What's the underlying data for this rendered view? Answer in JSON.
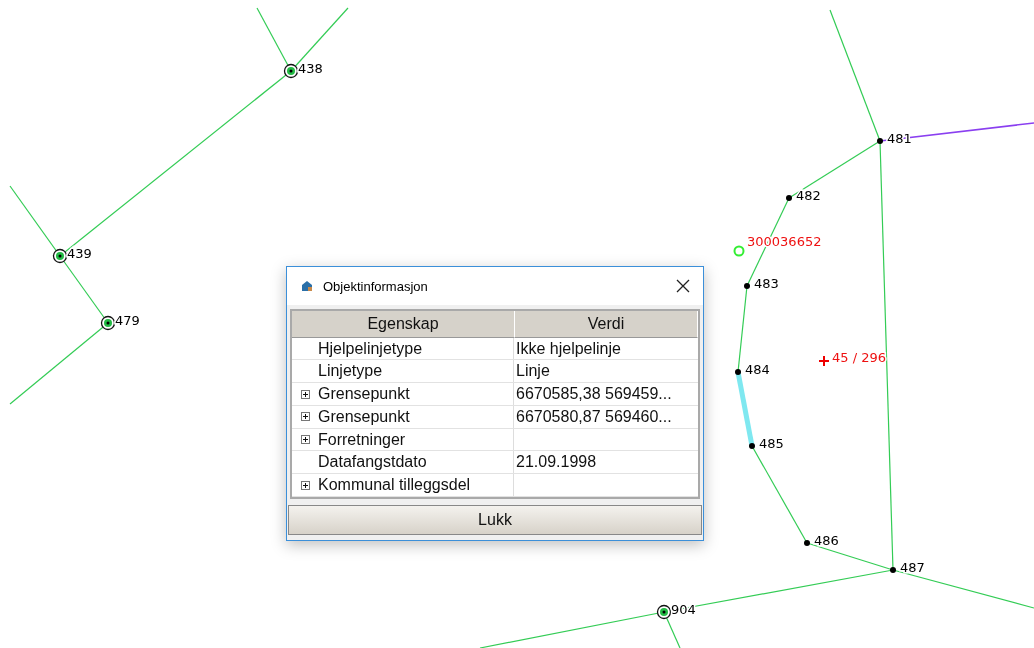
{
  "map": {
    "points": [
      {
        "label": "438",
        "kind": "ring"
      },
      {
        "label": "439",
        "kind": "ring"
      },
      {
        "label": "479",
        "kind": "ring"
      },
      {
        "label": "481",
        "kind": "dot"
      },
      {
        "label": "482",
        "kind": "dot"
      },
      {
        "label": "483",
        "kind": "dot"
      },
      {
        "label": "484",
        "kind": "dot"
      },
      {
        "label": "485",
        "kind": "dot"
      },
      {
        "label": "486",
        "kind": "dot"
      },
      {
        "label": "487",
        "kind": "dot"
      },
      {
        "label": "904",
        "kind": "ring"
      }
    ],
    "annotations": [
      {
        "text": "300036652",
        "kind": "circle"
      },
      {
        "text": "45 / 296",
        "kind": "cross"
      }
    ]
  },
  "dialog": {
    "title": "Objektinformasjon",
    "columns": [
      "Egenskap",
      "Verdi"
    ],
    "rows": [
      {
        "property": "Hjelpelinjetype",
        "value": "Ikke hjelpelinje",
        "expandable": false
      },
      {
        "property": "Linjetype",
        "value": "Linje",
        "expandable": false
      },
      {
        "property": "Grensepunkt",
        "value": "6670585,38 569459...",
        "expandable": true
      },
      {
        "property": "Grensepunkt",
        "value": "6670580,87 569460...",
        "expandable": true
      },
      {
        "property": "Forretninger",
        "value": "",
        "expandable": true
      },
      {
        "property": "Datafangstdato",
        "value": "21.09.1998",
        "expandable": false
      },
      {
        "property": "Kommunal tilleggsdel",
        "value": "",
        "expandable": true
      }
    ],
    "button": "Lukk"
  }
}
